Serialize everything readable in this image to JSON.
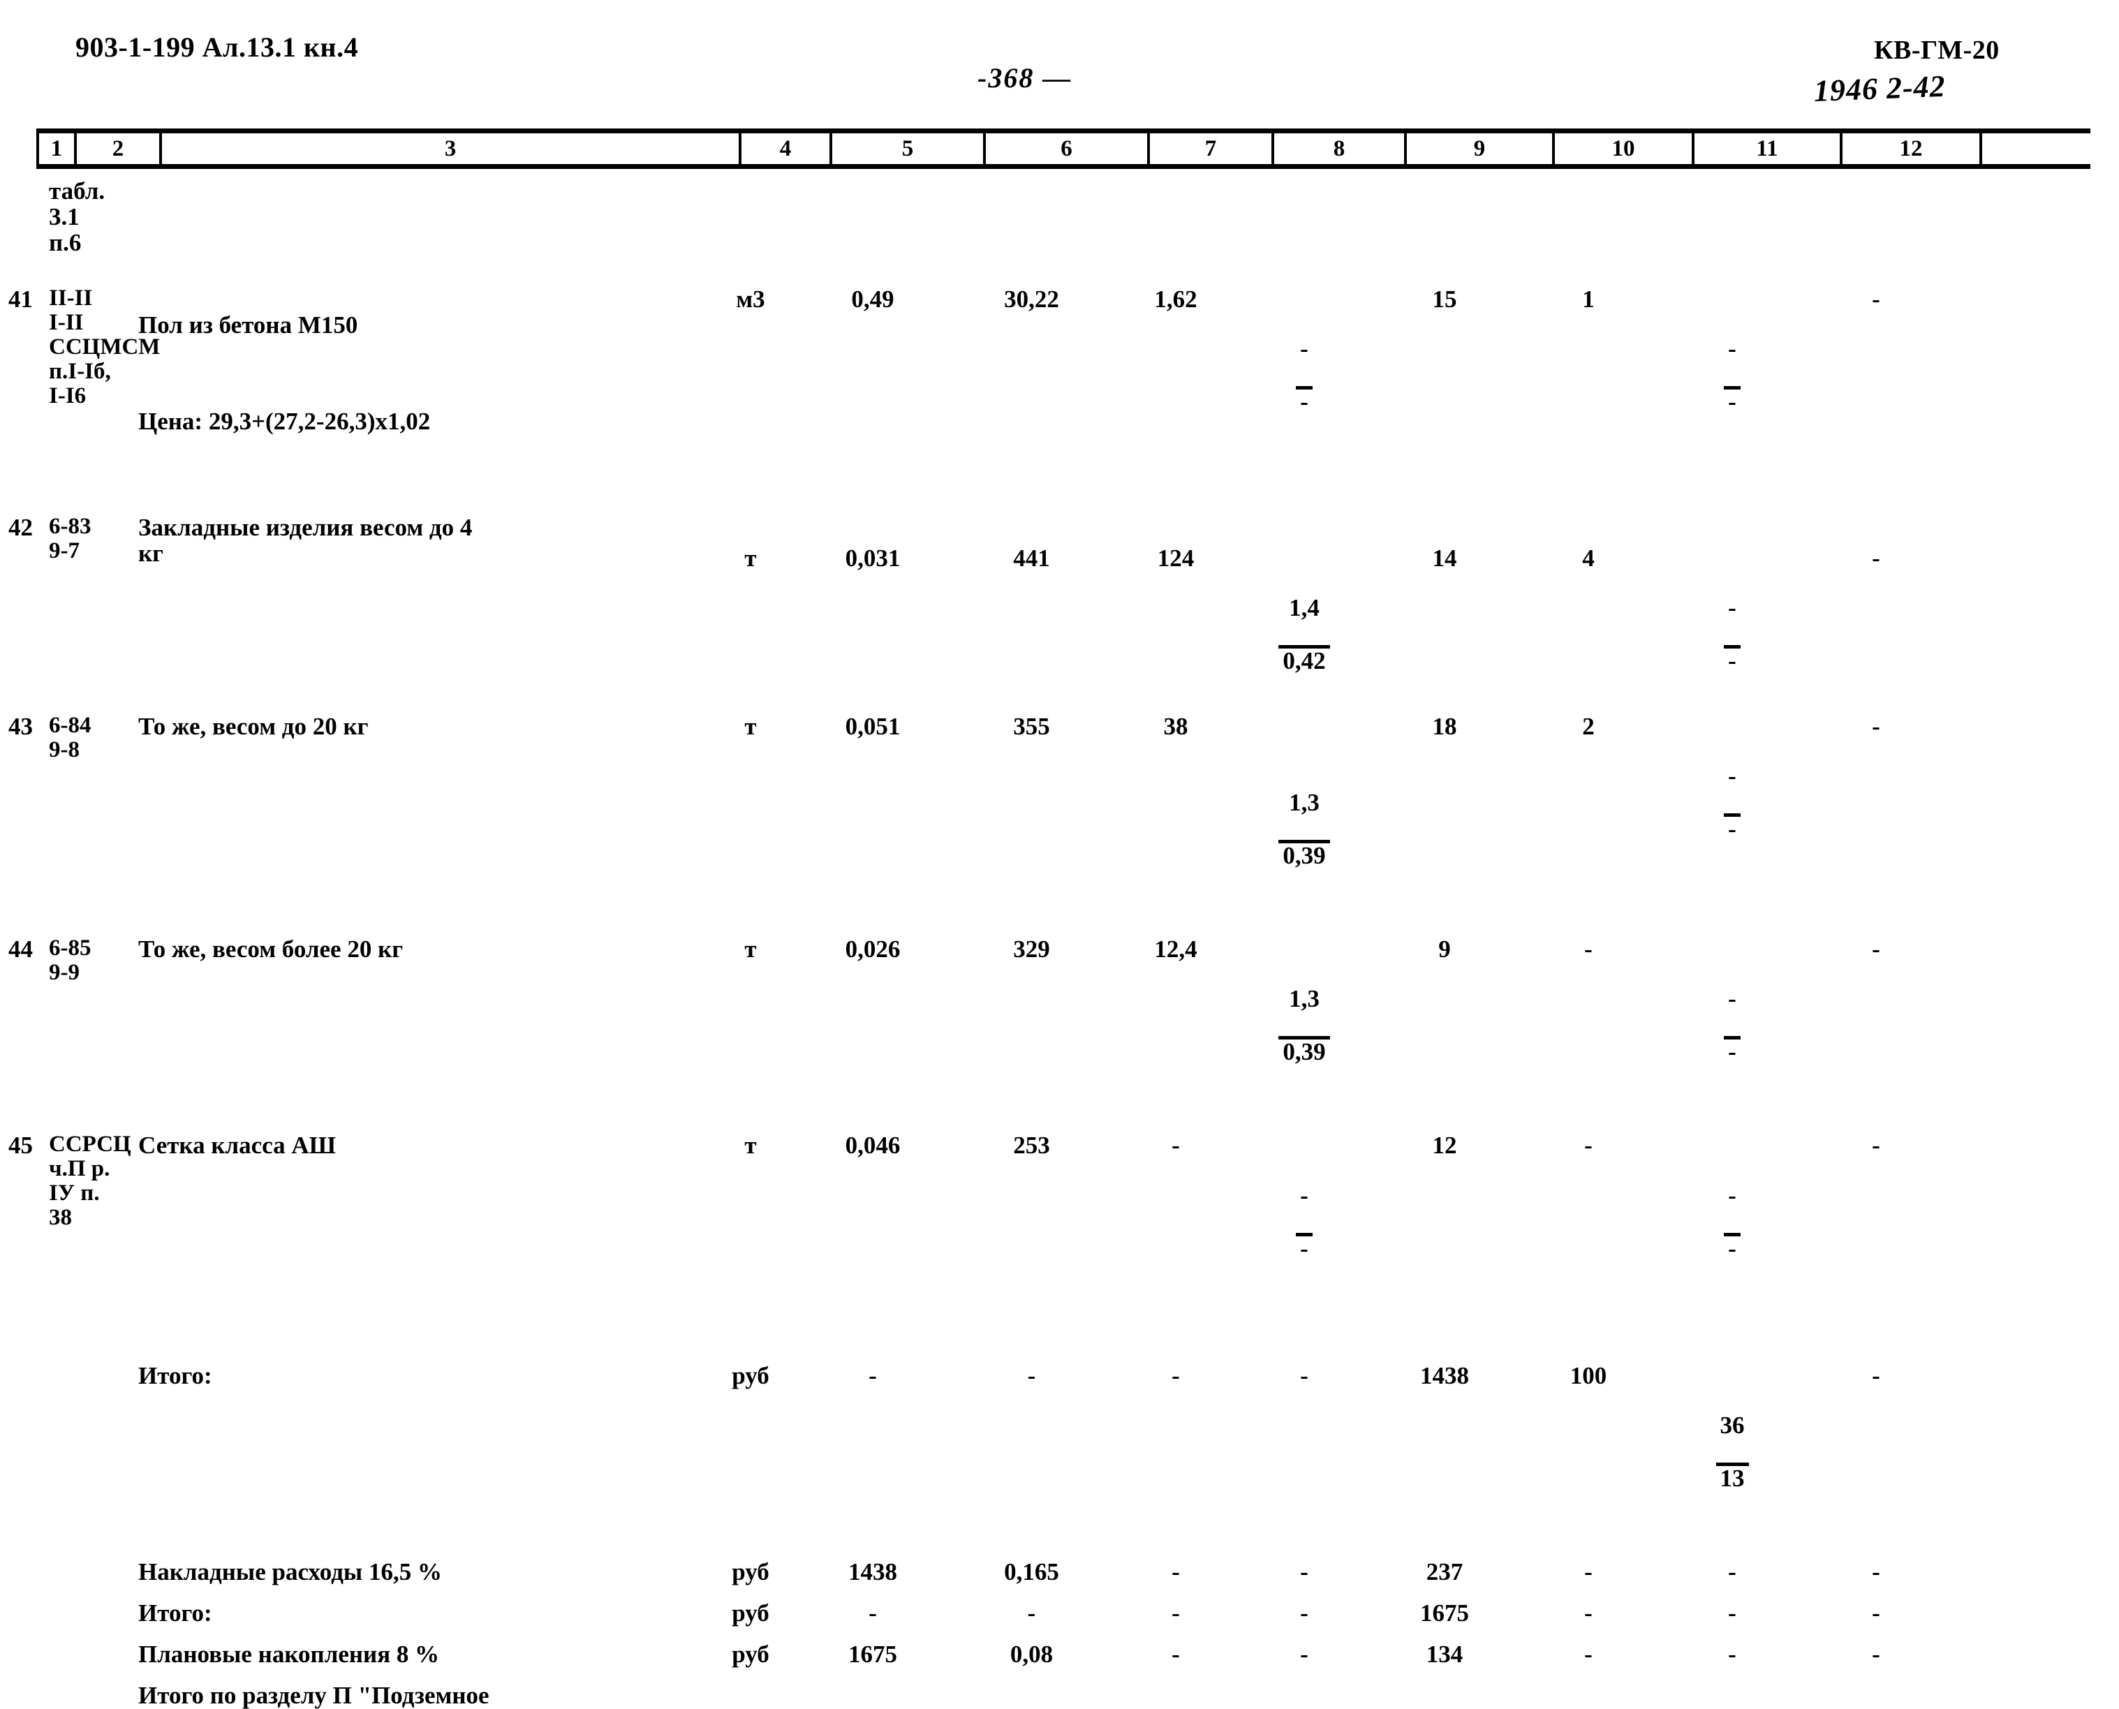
{
  "header": {
    "document_code": "903-1-199 Ал.13.1 кн.4",
    "page_number": "-368  —",
    "sheet_code": "КВ-ГМ-20",
    "stamp": "1946 2-42"
  },
  "column_numbers": [
    "1",
    "2",
    "3",
    "4",
    "5",
    "6",
    "7",
    "8",
    "9",
    "10",
    "11",
    "12"
  ],
  "note_block": "табл.\n3.1\nп.6",
  "rows": [
    {
      "num": "41",
      "code": "II-II\nI-II\nССЦМСМ\nп.I-Iб,\nI-I6",
      "description": "Пол из бетона М150",
      "description2": "Цена: 29,3+(27,2-26,3)х1,02",
      "unit": "м3",
      "c5": "0,49",
      "c6": "30,22",
      "c7": "1,62",
      "c8_num": "-",
      "c8_den": "-",
      "c9": "15",
      "c10": "1",
      "c11_num": "-",
      "c11_den": "-",
      "c12": "-"
    },
    {
      "num": "42",
      "code": "6-83\n9-7",
      "description": "Закладные изделия весом до 4\nкг",
      "unit": "т",
      "c5": "0,031",
      "c6": "441",
      "c7": "124",
      "c8_num": "1,4",
      "c8_den": "0,42",
      "c9": "14",
      "c10": "4",
      "c11_num": "-",
      "c11_den": "-",
      "c12": "-"
    },
    {
      "num": "43",
      "code": "6-84\n9-8",
      "description": "То же, весом до 20 кг",
      "unit": "т",
      "c5": "0,051",
      "c6": "355",
      "c7": "38",
      "c8_num": "1,3",
      "c8_den": "0,39",
      "c9": "18",
      "c10": "2",
      "c11_num": "-",
      "c11_den": "-",
      "c12": "-"
    },
    {
      "num": "44",
      "code": "6-85\n9-9",
      "description": "То же, весом более 20 кг",
      "unit": "т",
      "c5": "0,026",
      "c6": "329",
      "c7": "12,4",
      "c8_num": "1,3",
      "c8_den": "0,39",
      "c9": "9",
      "c10": "-",
      "c11_num": "-",
      "c11_den": "-",
      "c12": "-"
    },
    {
      "num": "45",
      "code": "ССРСЦ\nч.П р.\nIУ п.\n38",
      "description": "Сетка класса АШ",
      "unit": "т",
      "c5": "0,046",
      "c6": "253",
      "c7": "-",
      "c8_num": "-",
      "c8_den": "-",
      "c9": "12",
      "c10": "-",
      "c11_num": "-",
      "c11_den": "-",
      "c12": "-"
    }
  ],
  "summary_rows": [
    {
      "label": "Итого:",
      "unit": "руб",
      "c5": "-",
      "c6": "-",
      "c7": "-",
      "c8": "-",
      "c9": "1438",
      "c10": "100",
      "c11_num": "36",
      "c11_den": "13",
      "c12": "-"
    },
    {
      "label": "Накладные расходы 16,5 %",
      "unit": "руб",
      "c5": "1438",
      "c6": "0,165",
      "c7": "-",
      "c8": "-",
      "c9": "237",
      "c10": "-",
      "c11": "-",
      "c12": "-"
    },
    {
      "label": "Итого:",
      "unit": "руб",
      "c5": "-",
      "c6": "-",
      "c7": "-",
      "c8": "-",
      "c9": "1675",
      "c10": "-",
      "c11": "-",
      "c12": "-"
    },
    {
      "label": "Плановые накопления 8 %",
      "unit": "руб",
      "c5": "1675",
      "c6": "0,08",
      "c7": "-",
      "c8": "-",
      "c9": "134",
      "c10": "-",
      "c11": "-",
      "c12": "-"
    }
  ],
  "footer_line": "Итого по разделу П \"Подземное"
}
